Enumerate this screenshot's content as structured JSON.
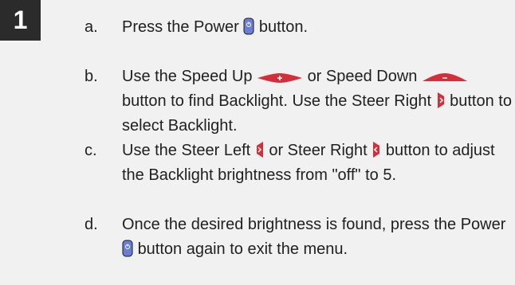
{
  "step_number": "1",
  "colors": {
    "accent_red": "#d32f3a",
    "power_blue": "#6b7dd6",
    "badge": "#2b2b2b"
  },
  "steps": [
    {
      "letter": "a.",
      "parts": [
        "Press the Power",
        "button."
      ],
      "icons": [
        "power-button-icon"
      ]
    },
    {
      "letter": "b.",
      "parts": [
        "Use the Speed Up",
        "or Speed Down",
        "button to find Backlight. Use the Steer Right",
        "button to select Backlight."
      ],
      "icons": [
        "speed-up-icon",
        "speed-down-icon",
        "steer-right-icon"
      ]
    },
    {
      "letter": "c.",
      "parts": [
        "Use the Steer Left",
        "or Steer Right",
        "button to adjust the Backlight brightness from \"off\" to 5."
      ],
      "icons": [
        "steer-left-icon",
        "steer-right-icon"
      ]
    },
    {
      "letter": "d.",
      "parts": [
        "Once the desired brightness is found, press the Power",
        "button again to exit the menu."
      ],
      "icons": [
        "power-button-icon"
      ]
    }
  ]
}
